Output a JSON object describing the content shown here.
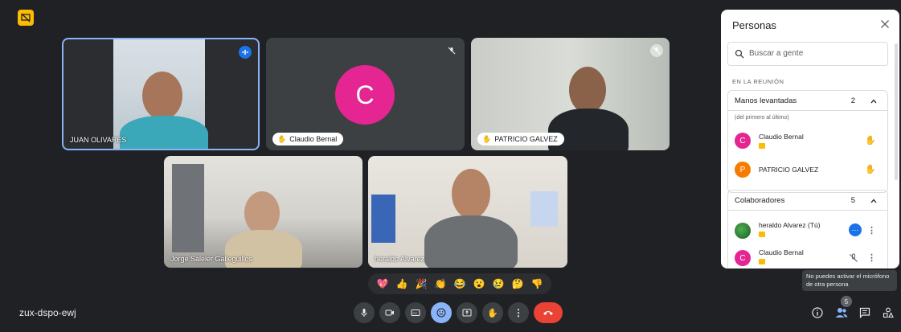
{
  "meeting": {
    "code": "zux-dspo-ewj"
  },
  "participants": [
    {
      "name": "JUAN OLIVARES"
    },
    {
      "name": "Claudio Bernal",
      "initial": "C"
    },
    {
      "name": "PATRICIO GALVEZ"
    },
    {
      "name": "Jorge Saleler Galleguillos"
    },
    {
      "name": "heraldo Alvarez"
    }
  ],
  "reactions": [
    "💖",
    "👍",
    "🎉",
    "👏",
    "😂",
    "😮",
    "😢",
    "🤔",
    "👎"
  ],
  "controls": {
    "people_count": "5"
  },
  "panel": {
    "title": "Personas",
    "search_placeholder": "Buscar a gente",
    "in_meeting_label": "EN LA REUNIÓN",
    "hands": {
      "title": "Manos levantadas",
      "count": "2",
      "note": "(del primero al último)",
      "people": [
        {
          "name": "Claudio Bernal",
          "initial": "C",
          "color": "#e52592"
        },
        {
          "name": "PATRICIO GALVEZ",
          "initial": "P",
          "color": "#f57c00"
        }
      ]
    },
    "collaborators": {
      "title": "Colaboradores",
      "count": "5",
      "people": [
        {
          "name": "heraldo Alvarez (Tú)"
        },
        {
          "name": "Claudio Bernal",
          "initial": "C",
          "color": "#e52592"
        }
      ]
    }
  },
  "tooltip": {
    "line1": "No puedes activar el micrófono",
    "line2": "de otra persona"
  },
  "colors": {
    "accent_blue": "#8ab4f8",
    "end_call": "#ea4335",
    "host_badge": "#fbbc04",
    "claudio": "#e52592"
  }
}
